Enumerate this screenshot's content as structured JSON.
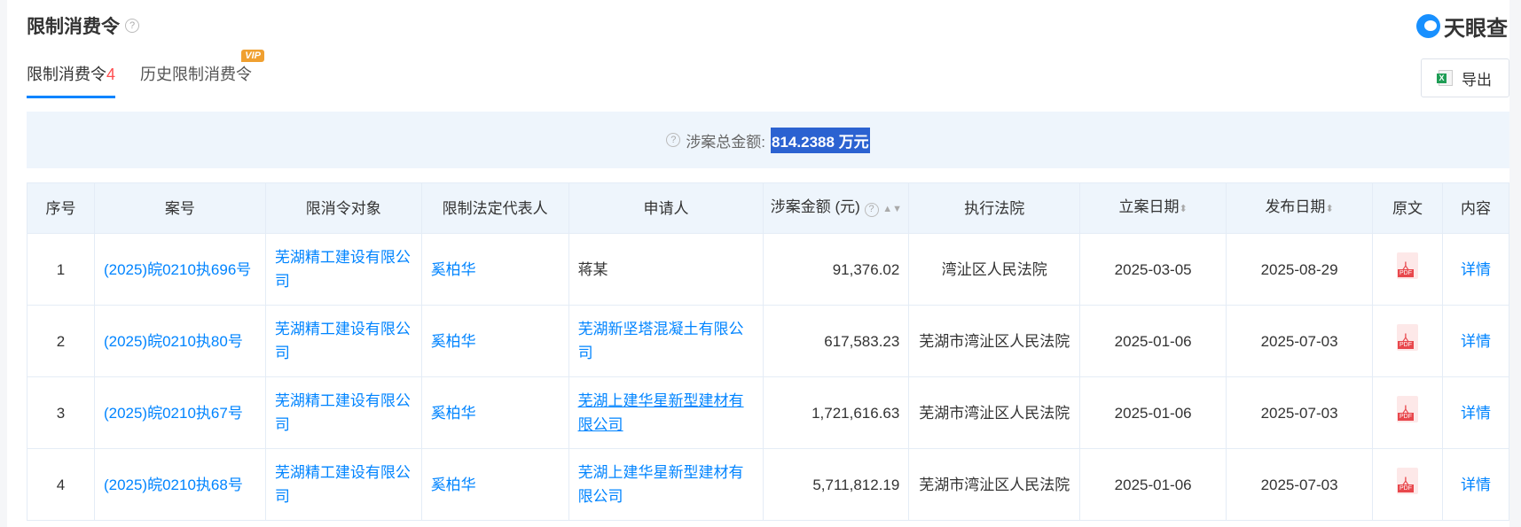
{
  "header": {
    "title": "限制消费令",
    "logo_text": "天眼查",
    "export_label": "导出"
  },
  "tabs": [
    {
      "label": "限制消费令",
      "count": "4"
    },
    {
      "label": "历史限制消费令",
      "badge": "VIP"
    }
  ],
  "summary": {
    "label": "涉案总金额:",
    "amount": "814.2388",
    "unit": "万元"
  },
  "table": {
    "headers": [
      "序号",
      "案号",
      "限消令对象",
      "限制法定代表人",
      "申请人",
      "涉案金额 (元)",
      "执行法院",
      "立案日期",
      "发布日期",
      "原文",
      "内容"
    ],
    "rows": [
      {
        "no": "1",
        "case": "(2025)皖0210执696号",
        "target": "芜湖精工建设有限公司",
        "rep": "奚柏华",
        "applicant": "蒋某",
        "amount": "91,376.02",
        "court": "湾沚区人民法院",
        "filed": "2025-03-05",
        "published": "2025-08-29",
        "detail": "详情"
      },
      {
        "no": "2",
        "case": "(2025)皖0210执80号",
        "target": "芜湖精工建设有限公司",
        "rep": "奚柏华",
        "applicant": "芜湖新坚塔混凝土有限公司",
        "amount": "617,583.23",
        "court": "芜湖市湾沚区人民法院",
        "filed": "2025-01-06",
        "published": "2025-07-03",
        "detail": "详情"
      },
      {
        "no": "3",
        "case": "(2025)皖0210执67号",
        "target": "芜湖精工建设有限公司",
        "rep": "奚柏华",
        "applicant": "芜湖上建华星新型建材有限公司",
        "amount": "1,721,616.63",
        "court": "芜湖市湾沚区人民法院",
        "filed": "2025-01-06",
        "published": "2025-07-03",
        "detail": "详情"
      },
      {
        "no": "4",
        "case": "(2025)皖0210执68号",
        "target": "芜湖精工建设有限公司",
        "rep": "奚柏华",
        "applicant": "芜湖上建华星新型建材有限公司",
        "amount": "5,711,812.19",
        "court": "芜湖市湾沚区人民法院",
        "filed": "2025-01-06",
        "published": "2025-07-03",
        "detail": "详情"
      }
    ]
  }
}
